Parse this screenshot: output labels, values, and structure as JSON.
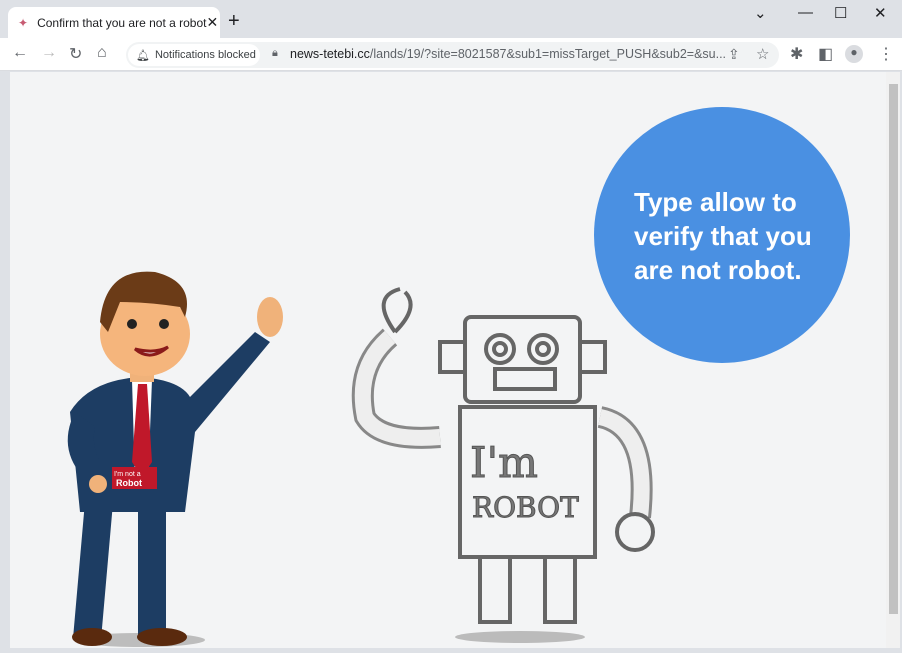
{
  "tab": {
    "title": "Confirm that you are not a robot",
    "favicon": "megaphone-icon"
  },
  "toolbar": {
    "notifications": "Notifications blocked",
    "url_domain": "news-tetebi.cc",
    "url_path": "/lands/19/?site=8021587&sub1=missTarget_PUSH&sub2=&su..."
  },
  "page": {
    "bubble_text": "Type allow to verify that you are not robot.",
    "bubble_color": "#4a90e2",
    "badge_line1": "I'm not a",
    "badge_line2": "Robot",
    "robot_text1": "I'm",
    "robot_text2": "ROBOT"
  }
}
